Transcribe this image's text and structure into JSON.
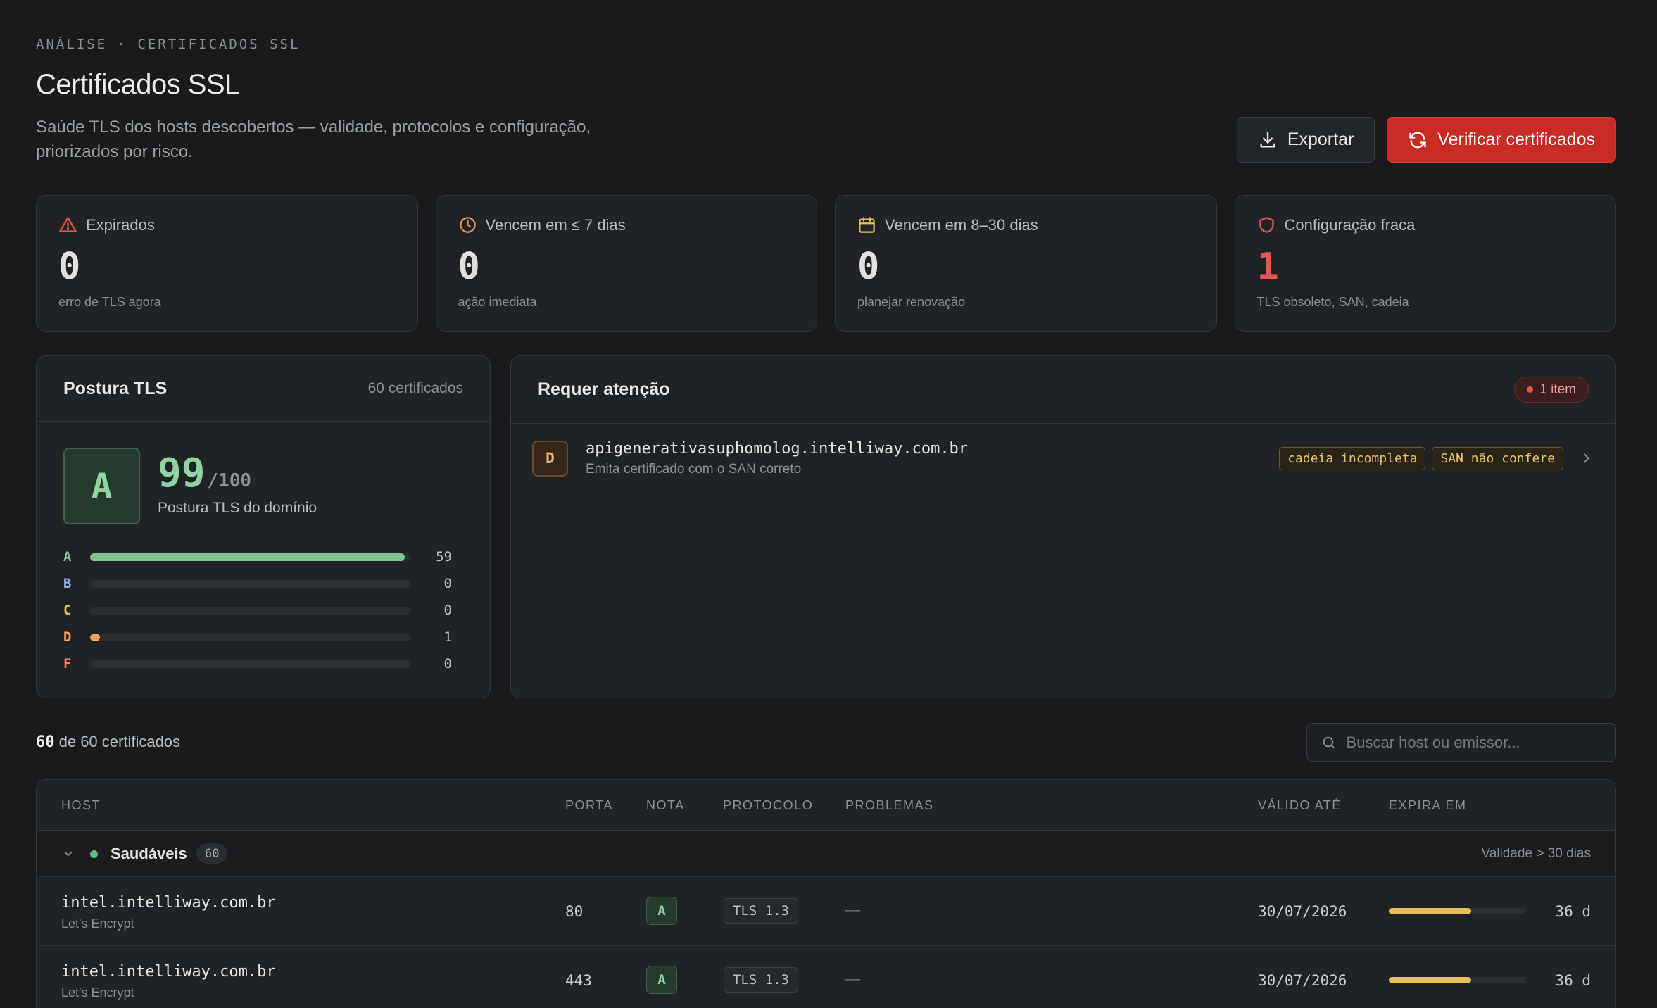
{
  "header": {
    "breadcrumb": "ANÁLISE · CERTIFICADOS SSL",
    "title": "Certificados SSL",
    "subtitle": "Saúde TLS dos hosts descobertos — validade, protocolos e configuração, priorizados por risco.",
    "export_label": "Exportar",
    "verify_label": "Verificar certificados"
  },
  "stats": [
    {
      "label": "Expirados",
      "value": "0",
      "note": "erro de TLS agora",
      "icon": "warning-icon",
      "color": "#e4574f"
    },
    {
      "label": "Vencem em ≤ 7 dias",
      "value": "0",
      "note": "ação imediata",
      "icon": "clock-icon",
      "color": "#e8934f"
    },
    {
      "label": "Vencem em 8–30 dias",
      "value": "0",
      "note": "planejar renovação",
      "icon": "calendar-icon",
      "color": "#e4bf5a"
    },
    {
      "label": "Configuração fraca",
      "value": "1",
      "note": "TLS obsoleto, SAN, cadeia",
      "icon": "shield-icon",
      "color": "#e4574f"
    }
  ],
  "posture": {
    "title": "Postura TLS",
    "meta": "60 certificados",
    "grade": "A",
    "score": "99",
    "score_max": "/100",
    "label": "Postura TLS do domínio",
    "distribution": [
      {
        "grade": "A",
        "count": 59,
        "color": "#7fc391"
      },
      {
        "grade": "B",
        "count": 0,
        "color": "#8fb2e8"
      },
      {
        "grade": "C",
        "count": 0,
        "color": "#e4bf5a"
      },
      {
        "grade": "D",
        "count": 1,
        "color": "#f0a45a"
      },
      {
        "grade": "F",
        "count": 0,
        "color": "#ec7b74"
      }
    ],
    "total": 60
  },
  "attention": {
    "title": "Requer atenção",
    "badge": "1 item",
    "items": [
      {
        "grade": "D",
        "host": "apigenerativasuphomolog.intelliway.com.br",
        "desc": "Emita certificado com o SAN correto",
        "tags": [
          "cadeia incompleta",
          "SAN não confere"
        ]
      }
    ]
  },
  "list": {
    "count_shown": "60",
    "count_rest": " de 60 certificados",
    "search_placeholder": "Buscar host ou emissor..."
  },
  "table": {
    "columns": [
      "HOST",
      "PORTA",
      "NOTA",
      "PROTOCOLO",
      "PROBLEMAS",
      "VÁLIDO ATÉ",
      "EXPIRA EM"
    ],
    "group": {
      "label": "Saudáveis",
      "count": "60",
      "note": "Validade > 30 dias"
    },
    "rows": [
      {
        "host": "intel.intelliway.com.br",
        "issuer": "Let's Encrypt",
        "port": "80",
        "grade": "A",
        "protocol": "TLS 1.3",
        "problems": "—",
        "valid_until": "30/07/2026",
        "expires": "36 d",
        "expiry_fraction": 0.6
      },
      {
        "host": "intel.intelliway.com.br",
        "issuer": "Let's Encrypt",
        "port": "443",
        "grade": "A",
        "protocol": "TLS 1.3",
        "problems": "—",
        "valid_until": "30/07/2026",
        "expires": "36 d",
        "expiry_fraction": 0.6
      }
    ]
  }
}
